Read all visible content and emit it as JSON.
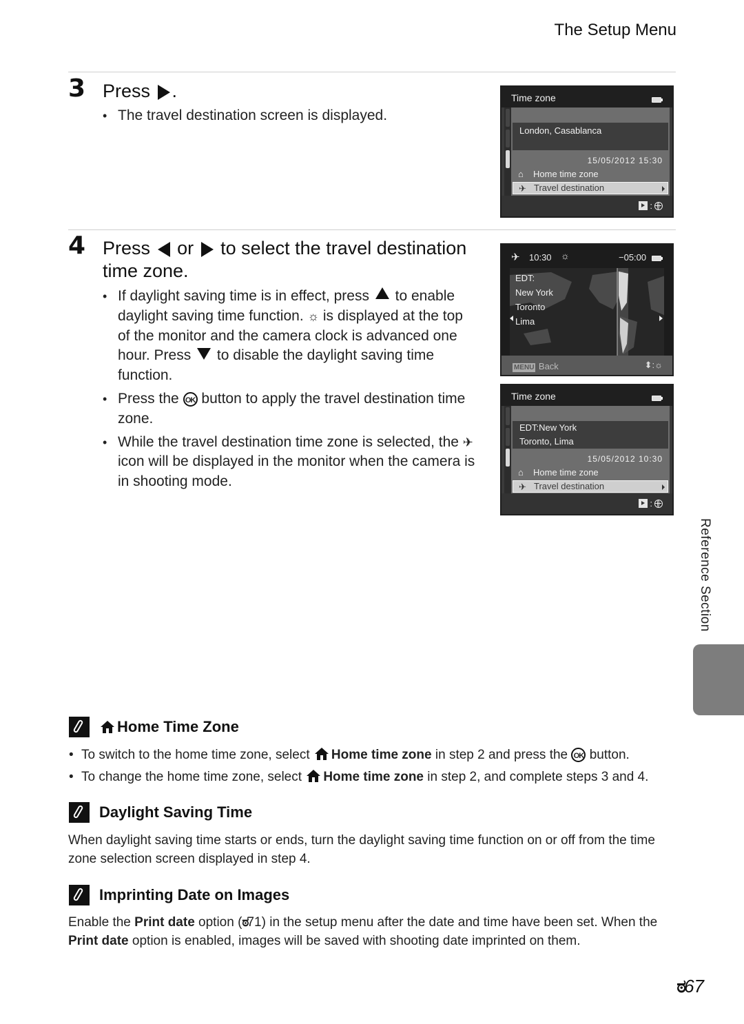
{
  "header": {
    "section_title": "The Setup Menu"
  },
  "steps": [
    {
      "number": "3",
      "title_prefix": "Press",
      "title_suffix": ".",
      "bullets": [
        {
          "text": "The travel destination screen is displayed."
        }
      ]
    },
    {
      "number": "4",
      "title_parts": {
        "a": "Press",
        "b": "or",
        "c": "to select the travel destination time zone."
      },
      "bullets": [
        {
          "a": "If daylight saving time is in effect, press",
          "b": "to enable daylight saving time function.",
          "c": "is displayed at the top of the monitor and the camera clock is advanced one hour. Press",
          "d": "to disable the daylight saving time function."
        },
        {
          "a": "Press the",
          "b": "button to apply the travel destination time zone."
        },
        {
          "a": "While the travel destination time zone is selected, the",
          "b": "icon will be displayed in the monitor when the camera is in shooting mode."
        }
      ]
    }
  ],
  "screens": {
    "screen1": {
      "title": "Time zone",
      "location_lines": [
        "London, Casablanca"
      ],
      "datetime": "15/05/2012 15:30",
      "menu": [
        {
          "icon": "home-icon",
          "label": "Home time zone",
          "selected": false
        },
        {
          "icon": "airplane-icon",
          "label": "Travel destination",
          "selected": true
        }
      ]
    },
    "screen2": {
      "time": "10:30",
      "offset": "−05:00",
      "zone_label": "EDT:",
      "cities": [
        "New York",
        "Toronto",
        "Lima"
      ],
      "menu_chip": "MENU",
      "back_label": "Back"
    },
    "screen3": {
      "title": "Time zone",
      "location_lines": [
        "EDT:New York",
        "Toronto, Lima"
      ],
      "datetime": "15/05/2012 10:30",
      "menu": [
        {
          "icon": "home-icon",
          "label": "Home time zone",
          "selected": false
        },
        {
          "icon": "airplane-icon",
          "label": "Travel destination",
          "selected": true
        }
      ]
    }
  },
  "notes": {
    "home_time_zone": {
      "title": "Home Time Zone",
      "bullets": [
        {
          "a": "To switch to the home time zone, select",
          "bold": "Home time zone",
          "b": "in step 2 and press the",
          "c": "button."
        },
        {
          "a": "To change the home time zone, select",
          "bold": "Home time zone",
          "b": "in step 2, and complete steps 3 and 4."
        }
      ]
    },
    "daylight_saving": {
      "title": "Daylight Saving Time",
      "text": "When daylight saving time starts or ends, turn the daylight saving time function on or off from the time zone selection screen displayed in step 4."
    },
    "imprinting": {
      "title": "Imprinting Date on Images",
      "a": "Enable the",
      "bold1": "Print date",
      "b": "option (",
      "ref": "71",
      "c": ") in the setup menu after the date and time have been set. When the",
      "bold2": "Print date",
      "d": "option is enabled, images will be saved with shooting date imprinted on them."
    }
  },
  "side_label": "Reference Section",
  "page_number": "67",
  "ok_label": "OK",
  "colors": {
    "side_tab": "#7d7d7d",
    "screen_bg": "#3a3a3a"
  }
}
